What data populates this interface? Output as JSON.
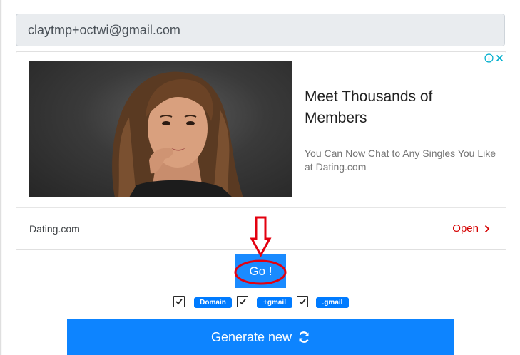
{
  "email": {
    "value": "claytmp+octwi@gmail.com"
  },
  "ad": {
    "headline": "Meet Thousands of Members",
    "body": "You Can Now Chat to Any Singles You Like at Dating.com",
    "advertiser": "Dating.com",
    "cta": "Open",
    "icons": [
      "info-icon",
      "close-icon",
      "chevron-right-icon"
    ]
  },
  "go_button": {
    "label": "Go !"
  },
  "options": [
    {
      "label": "Domain",
      "checked": true
    },
    {
      "label": "+gmail",
      "checked": true
    },
    {
      "label": ".gmail",
      "checked": true
    }
  ],
  "generate_button": {
    "label": "Generate new",
    "icon": "refresh-icon"
  },
  "colors": {
    "primary": "#007bff",
    "annotation_red": "#e3000f",
    "ad_cta": "#d50000",
    "ad_info": "#00aecd"
  }
}
